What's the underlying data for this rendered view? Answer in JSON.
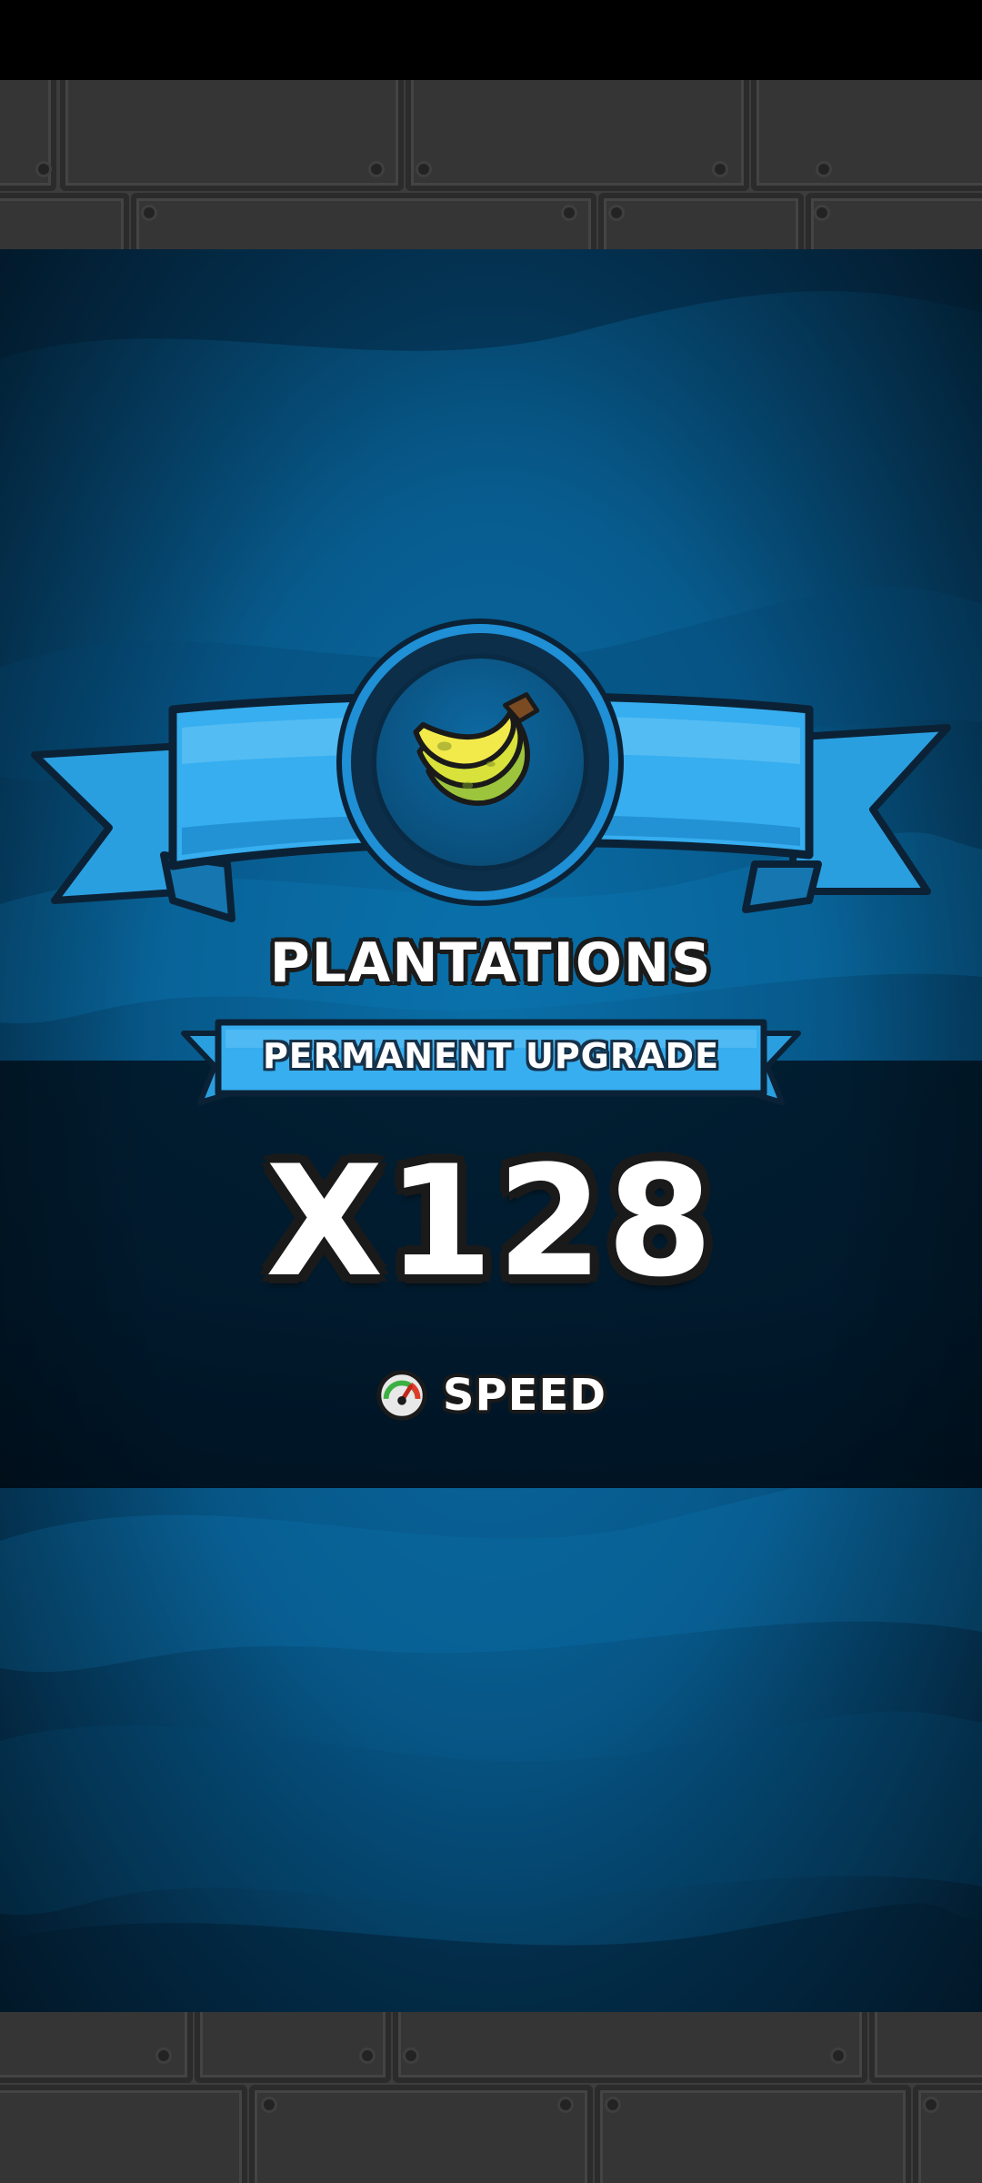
{
  "reward": {
    "icon": "banana-icon",
    "title": "PLANTATIONS",
    "subtitle": "PERMANENT UPGRADE",
    "multiplier": "X128",
    "stat_icon": "speedometer-icon",
    "stat_label": "SPEED"
  },
  "colors": {
    "panel_blue": "#0a6fa8",
    "ribbon_blue": "#2ea4e6",
    "wall_gray": "#3d3d3d",
    "text_white": "#ffffff",
    "outline_dark": "#1a1a1a"
  }
}
